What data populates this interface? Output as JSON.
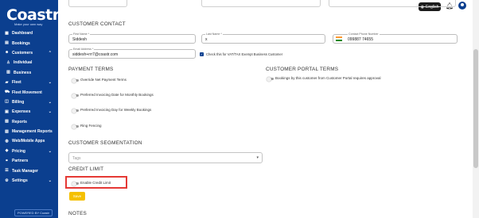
{
  "brand": {
    "logo": "Coastr",
    "tagline": "Make your own way",
    "powered": "POWERED BY Coastr"
  },
  "sidebar": {
    "items": [
      {
        "label": "Dashboard",
        "icon": "grid-icon",
        "chevron": ""
      },
      {
        "label": "Bookings",
        "icon": "calendar-icon",
        "chevron": ""
      },
      {
        "label": "Customers",
        "icon": "users-icon",
        "chevron": "⌃"
      },
      {
        "label": "Individual",
        "icon": "person-icon",
        "chevron": "",
        "sub": true
      },
      {
        "label": "Business",
        "icon": "building-icon",
        "chevron": "",
        "sub": true
      },
      {
        "label": "Fleet",
        "icon": "car-icon",
        "chevron": "⌄"
      },
      {
        "label": "Fleet Movement",
        "icon": "truck-icon",
        "chevron": ""
      },
      {
        "label": "Billing",
        "icon": "billing-icon",
        "chevron": "⌄"
      },
      {
        "label": "Expenses",
        "icon": "expenses-icon",
        "chevron": "⌄"
      },
      {
        "label": "Reports",
        "icon": "reports-icon",
        "chevron": ""
      },
      {
        "label": "Management Reports",
        "icon": "chart-icon",
        "chevron": ""
      },
      {
        "label": "Web/Mobile Apps",
        "icon": "globe-icon",
        "chevron": ""
      },
      {
        "label": "Pricing",
        "icon": "tag-icon",
        "chevron": "⌄"
      },
      {
        "label": "Partners",
        "icon": "handshake-icon",
        "chevron": ""
      },
      {
        "label": "Task Manager",
        "icon": "task-icon",
        "chevron": ""
      },
      {
        "label": "Settings",
        "icon": "gear-icon",
        "chevron": "⌄"
      }
    ]
  },
  "topbar": {
    "language": "English"
  },
  "contact": {
    "title": "CUSTOMER CONTACT",
    "first_name_label": "First Name *",
    "first_name": "Siddesh",
    "last_name_label": "Last Name *",
    "last_name": "x",
    "phone_label": "Contact Phone Number",
    "phone": "099887 74655",
    "email_label": "Email Address *",
    "email": "siddesh+rrr7@coastr.com",
    "vattax_label": "Check this for VAT/TAX Exempt Business Customer"
  },
  "payment": {
    "title": "PAYMENT TERMS",
    "items": [
      "Override Net Payment Terms",
      "Preferred Invoicing Date for Monthly Bookings",
      "Preferred Invoicing Day for Weekly Bookings",
      "Ring Fencing"
    ]
  },
  "portal": {
    "title": "CUSTOMER PORTAL TERMS",
    "item": "Bookings by this customer from Customer Portal requires approval"
  },
  "segmentation": {
    "title": "CUSTOMER SEGMENTATION",
    "tags_placeholder": "Tags"
  },
  "credit": {
    "title": "CREDIT LIMIT",
    "toggle_label": "Enable Credit Limit"
  },
  "actions": {
    "save": "Save"
  },
  "notes": {
    "title": "NOTES"
  },
  "colors": {
    "sidebar": "#0b3f8f",
    "save": "#f5c000",
    "highlight": "#e53935"
  }
}
